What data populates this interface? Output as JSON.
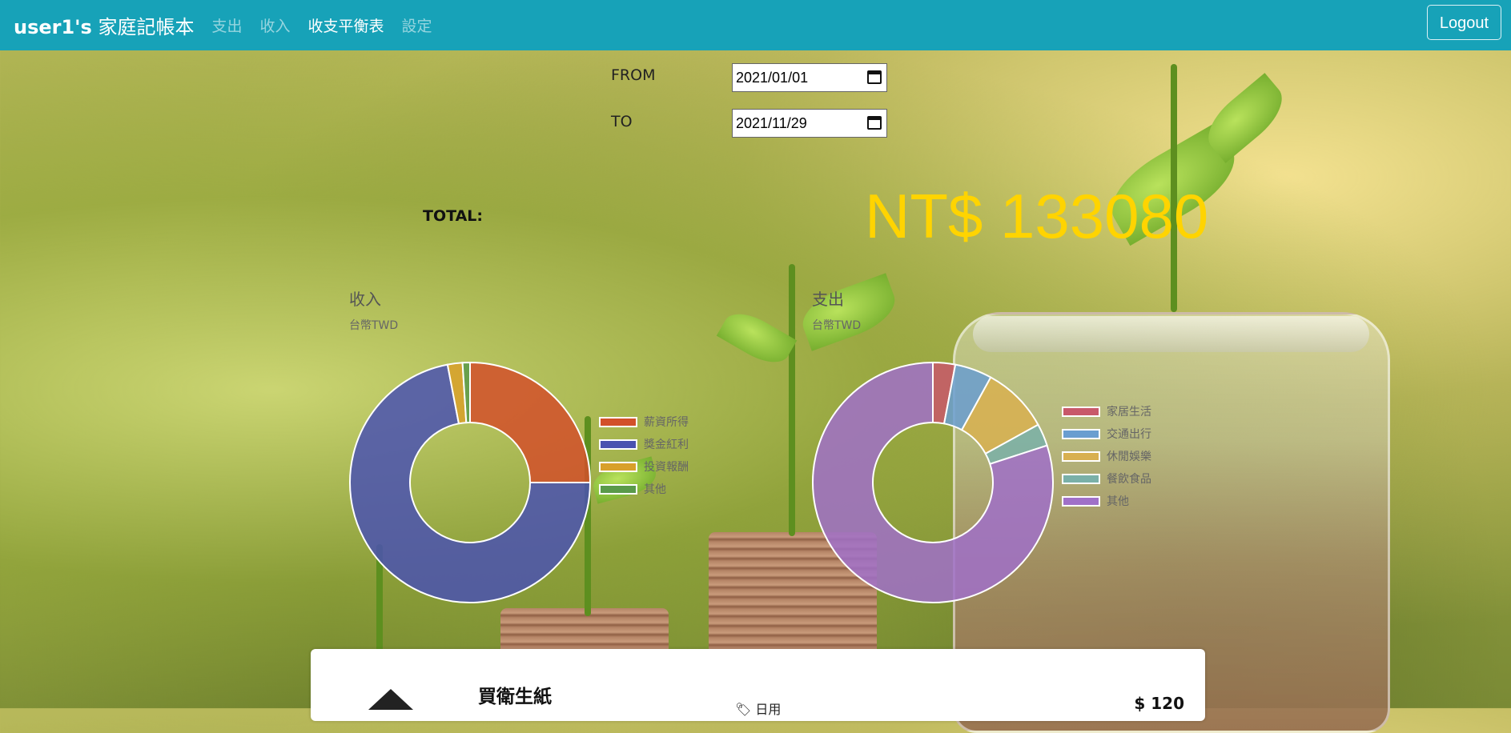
{
  "navbar": {
    "brand_user": "user1's",
    "brand_title": "家庭記帳本",
    "links": [
      "支出",
      "收入",
      "收支平衡表",
      "設定"
    ],
    "active_link": "收支平衡表",
    "logout_label": "Logout"
  },
  "filters": {
    "from_label": "FROM",
    "from_value": "2021/01/01",
    "to_label": "TO",
    "to_value": "2021/11/29"
  },
  "total": {
    "label": "TOTAL:",
    "value": "NT$ 133080",
    "color": "#ffd400"
  },
  "chart_data": [
    {
      "type": "pie",
      "title": "收入",
      "subtitle": "台幣TWD",
      "labels": [
        "薪資所得",
        "獎金紅利",
        "投資報酬",
        "其他"
      ],
      "values": [
        25,
        72,
        2,
        1
      ],
      "colors": [
        "#d2502a",
        "#4a52b0",
        "#d8a02a",
        "#5a9a4a"
      ]
    },
    {
      "type": "pie",
      "title": "支出",
      "subtitle": "台幣TWD",
      "labels": [
        "家居生活",
        "交通出行",
        "休閒娛樂",
        "餐飲食品",
        "其他"
      ],
      "values": [
        3,
        5,
        9,
        3,
        80
      ],
      "colors": [
        "#c8586a",
        "#6a9ed0",
        "#d8b050",
        "#7ab0a8",
        "#a070c8"
      ]
    }
  ],
  "card": {
    "title": "買衛生紙",
    "sub": "🏷 日用",
    "amount": "$ 120"
  }
}
